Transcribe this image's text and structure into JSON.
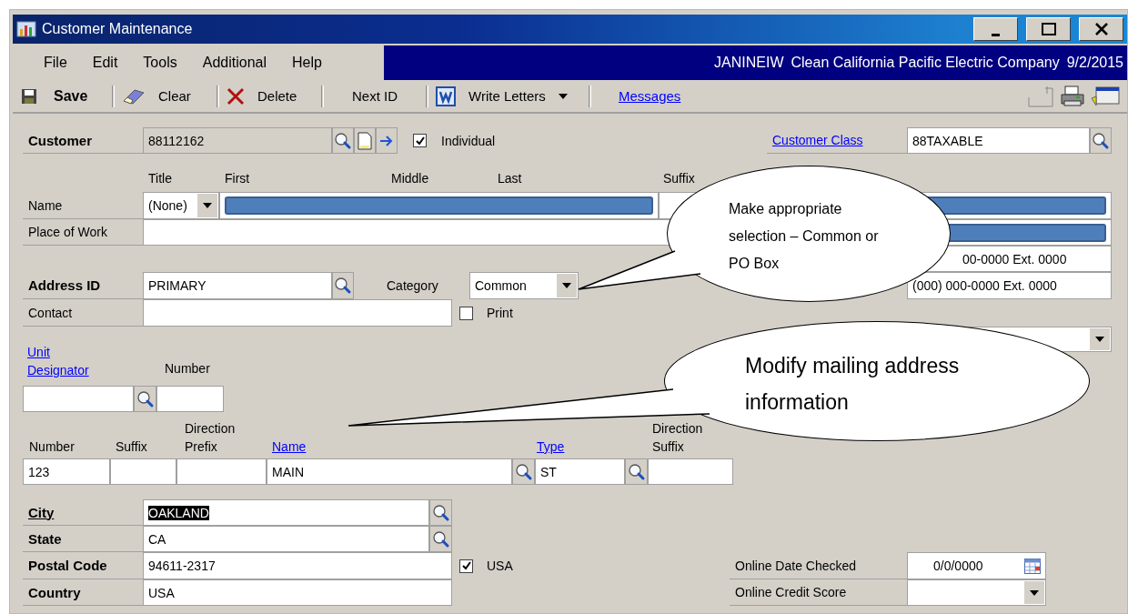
{
  "window": {
    "title": "Customer Maintenance"
  },
  "menu": [
    {
      "label": "File"
    },
    {
      "label": "Edit"
    },
    {
      "label": "Tools"
    },
    {
      "label": "Additional"
    },
    {
      "label": "Help"
    }
  ],
  "session": {
    "user": "JANINEIW",
    "company": "Clean California Pacific Electric Company",
    "date": "9/2/2015"
  },
  "toolbar": [
    {
      "kind": "save",
      "label": "Save"
    },
    {
      "kind": "clear",
      "label": "Clear"
    },
    {
      "kind": "delete",
      "label": "Delete"
    },
    {
      "kind": "plain",
      "label": "Next ID"
    },
    {
      "kind": "letters",
      "label": "Write Letters"
    },
    {
      "kind": "link",
      "label": "Messages"
    }
  ],
  "form": {
    "customer": {
      "label": "Customer",
      "value": "88112162"
    },
    "individual": {
      "label": "Individual",
      "checked": true
    },
    "customer_class": {
      "label": "Customer Class",
      "value": "88TAXABLE"
    },
    "name_headers": [
      "Title",
      "First",
      "Middle",
      "Last",
      "Suffix"
    ],
    "name": {
      "label": "Name",
      "title": "(None)",
      "redacted": true
    },
    "place_of_work": {
      "label": "Place of Work"
    },
    "right_fields": [
      {
        "redacted": true
      },
      {
        "redacted": true
      },
      {
        "value": "00-0000  Ext. 0000"
      },
      {
        "value": "(000) 000-0000  Ext. 0000"
      }
    ],
    "address_id": {
      "label": "Address ID",
      "value": "PRIMARY"
    },
    "category": {
      "label": "Category",
      "value": "Common"
    },
    "contact": {
      "label": "Contact"
    },
    "print": {
      "label": "Print",
      "checked": false
    },
    "unit_designator": {
      "label": "Unit Designator"
    },
    "unit_number": {
      "label": "Number"
    },
    "street_headers": [
      {
        "label": "Number",
        "link": false
      },
      {
        "label": "Suffix",
        "link": false
      },
      {
        "label": "Direction Prefix",
        "link": false
      },
      {
        "label": "Name",
        "link": true
      },
      {
        "label": "Type",
        "link": true
      },
      {
        "label": "Direction Suffix",
        "link": false
      }
    ],
    "street_fields": [
      {
        "value": "123",
        "lookup": false
      },
      {
        "lookup": false
      },
      {
        "lookup": false
      },
      {
        "value": "MAIN",
        "lookup": true
      },
      {
        "value": "ST",
        "lookup": true
      },
      {
        "lookup": false
      }
    ],
    "city": {
      "label": "City",
      "value": "OAKLAND",
      "selected": true
    },
    "state": {
      "label": "State",
      "value": "CA"
    },
    "postal_code": {
      "label": "Postal Code",
      "value": "94611-2317"
    },
    "usa": {
      "label": "USA",
      "checked": true
    },
    "country": {
      "label": "Country",
      "value": "USA"
    },
    "online_date_checked": {
      "label": "Online Date Checked",
      "value": "0/0/0000"
    },
    "online_credit_score": {
      "label": "Online Credit Score"
    }
  },
  "callouts": [
    {
      "text": "Make appropriate selection – Common or PO Box"
    },
    {
      "text": "Modify mailing address information"
    }
  ]
}
